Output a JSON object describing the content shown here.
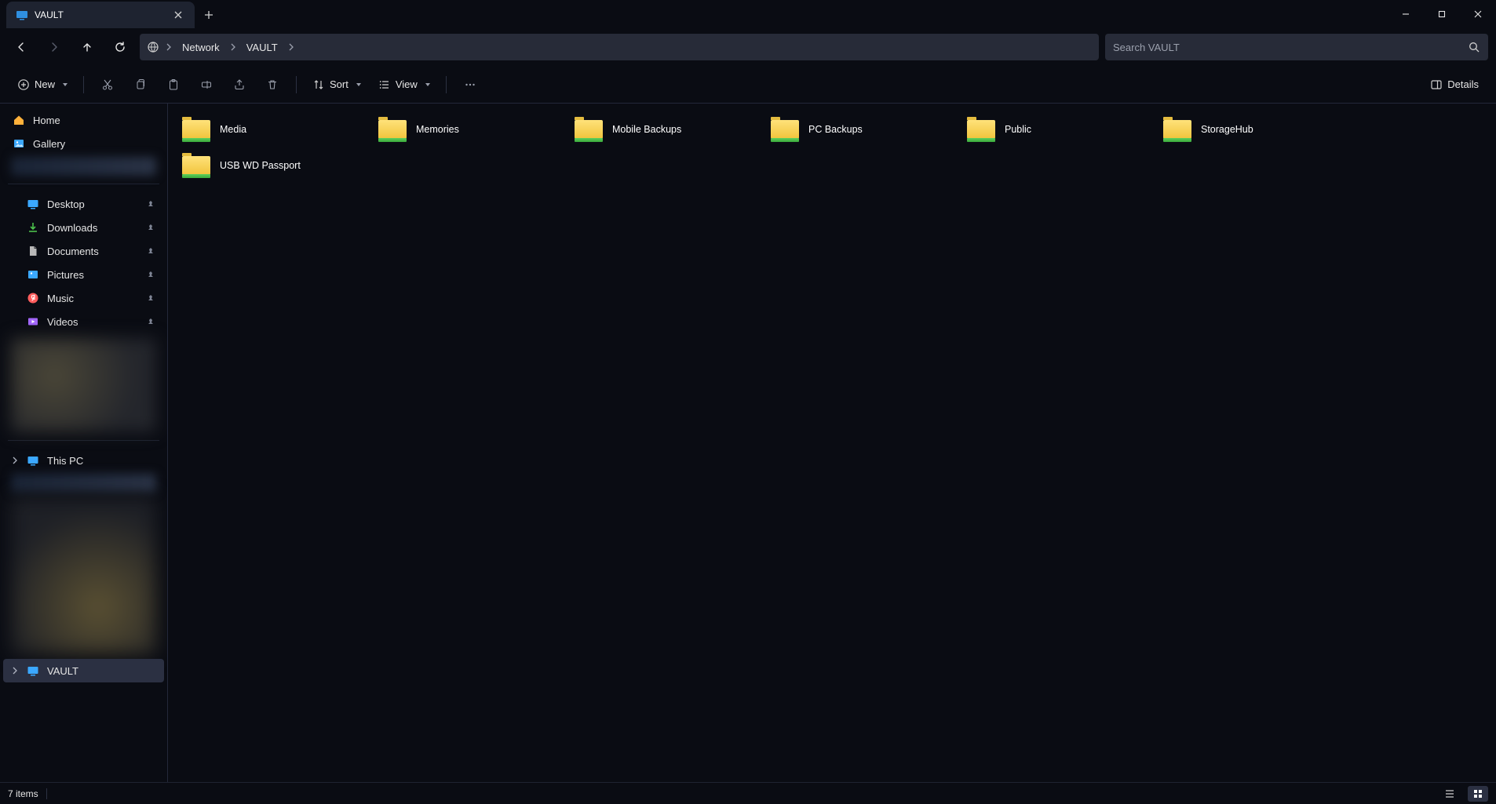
{
  "tab": {
    "title": "VAULT"
  },
  "nav": {
    "breadcrumb": [
      "Network",
      "VAULT"
    ]
  },
  "search": {
    "placeholder": "Search VAULT"
  },
  "toolbar": {
    "new": "New",
    "sort": "Sort",
    "view": "View",
    "details": "Details"
  },
  "sidebar": {
    "home": "Home",
    "gallery": "Gallery",
    "quick": [
      {
        "label": "Desktop"
      },
      {
        "label": "Downloads"
      },
      {
        "label": "Documents"
      },
      {
        "label": "Pictures"
      },
      {
        "label": "Music"
      },
      {
        "label": "Videos"
      }
    ],
    "thispc": "This PC",
    "vault": "VAULT"
  },
  "folders": [
    {
      "name": "Media"
    },
    {
      "name": "Memories"
    },
    {
      "name": "Mobile Backups"
    },
    {
      "name": "PC Backups"
    },
    {
      "name": "Public"
    },
    {
      "name": "StorageHub"
    },
    {
      "name": "USB WD Passport"
    }
  ],
  "status": {
    "items": "7 items"
  }
}
